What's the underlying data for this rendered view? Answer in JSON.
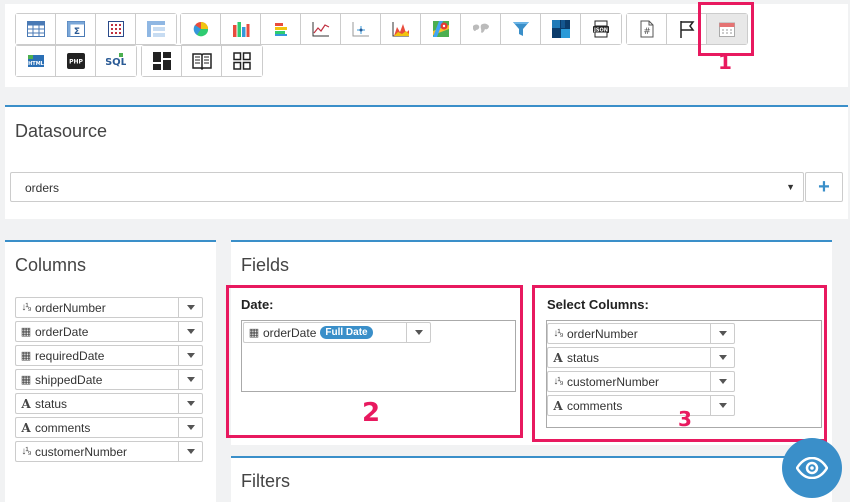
{
  "toolbar": {
    "row1_group1": [
      "table-icon",
      "pivot-sum-icon",
      "crosstab-icon",
      "treegrid-icon"
    ],
    "row1_group2": [
      "pie-chart-icon",
      "bar-chart-icon",
      "stacked-bar-icon",
      "line-chart-icon",
      "scatter-chart-icon",
      "area-chart-icon",
      "map-icon",
      "world-map-icon",
      "funnel-icon",
      "heatmap-icon",
      "json-icon"
    ],
    "row1_group3": [
      "number-widget-icon",
      "flag-icon",
      "calendar-icon"
    ],
    "row2_group1": [
      "html-icon",
      "php-icon",
      "sql-icon"
    ],
    "row2_group2": [
      "dashboard-icon",
      "book-icon",
      "grid-icon"
    ],
    "json_label": "JSON",
    "html_label": "HTML",
    "php_label": "PHP",
    "sql_label": "SQL"
  },
  "highlights": {
    "one": "1",
    "two": "2",
    "three": "3"
  },
  "datasource": {
    "title": "Datasource",
    "selected": "orders",
    "add_label": "+"
  },
  "columns": {
    "title": "Columns",
    "items": [
      {
        "label": "orderNumber",
        "type": "number"
      },
      {
        "label": "orderDate",
        "type": "date"
      },
      {
        "label": "requiredDate",
        "type": "date"
      },
      {
        "label": "shippedDate",
        "type": "date"
      },
      {
        "label": "status",
        "type": "text"
      },
      {
        "label": "comments",
        "type": "text"
      },
      {
        "label": "customerNumber",
        "type": "number"
      }
    ]
  },
  "fields": {
    "title": "Fields",
    "date_label": "Date:",
    "date_item": {
      "label": "orderDate",
      "badge": "Full Date"
    },
    "select_label": "Select Columns:",
    "select_items": [
      {
        "label": "orderNumber",
        "type": "number"
      },
      {
        "label": "status",
        "type": "text"
      },
      {
        "label": "customerNumber",
        "type": "number"
      },
      {
        "label": "comments",
        "type": "text"
      }
    ]
  },
  "filters": {
    "title": "Filters"
  },
  "colors": {
    "accent": "#3a8fc9",
    "highlight": "#e8195f"
  }
}
